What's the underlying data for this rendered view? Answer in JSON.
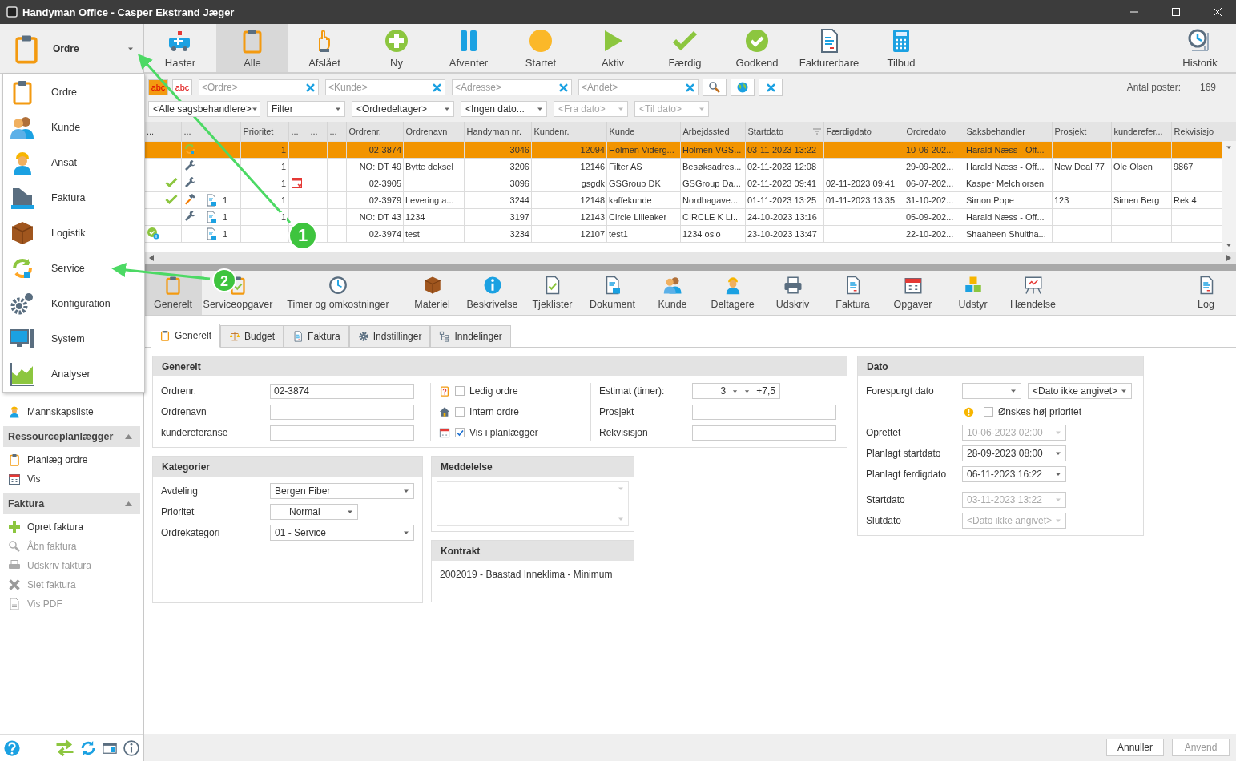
{
  "window": {
    "title": "Handyman Office - Casper Ekstrand Jæger"
  },
  "module_selector": {
    "label": "Ordre"
  },
  "module_menu": [
    {
      "label": "Ordre"
    },
    {
      "label": "Kunde"
    },
    {
      "label": "Ansat"
    },
    {
      "label": "Faktura"
    },
    {
      "label": "Logistik"
    },
    {
      "label": "Service"
    },
    {
      "label": "Konfiguration"
    },
    {
      "label": "System"
    },
    {
      "label": "Analyser"
    }
  ],
  "sidebar": {
    "items": [
      {
        "label": "Mannskapsliste",
        "disabled": false
      }
    ],
    "sections": [
      {
        "title": "Ressourceplanlægger",
        "expanded": true,
        "items": [
          {
            "label": "Planlæg ordre",
            "disabled": false
          },
          {
            "label": "Vis",
            "disabled": false
          }
        ]
      },
      {
        "title": "Faktura",
        "expanded": true,
        "items": [
          {
            "label": "Opret faktura",
            "disabled": false
          },
          {
            "label": "Åbn faktura",
            "disabled": true
          },
          {
            "label": "Udskriv faktura",
            "disabled": true
          },
          {
            "label": "Slet faktura",
            "disabled": true
          },
          {
            "label": "Vis PDF",
            "disabled": true
          }
        ]
      }
    ]
  },
  "toolbar": [
    {
      "label": "Haster",
      "selected": false
    },
    {
      "label": "Alle",
      "selected": true
    },
    {
      "label": "Afslået",
      "selected": false
    },
    {
      "label": "Ny",
      "selected": false
    },
    {
      "label": "Afventer",
      "selected": false
    },
    {
      "label": "Startet",
      "selected": false
    },
    {
      "label": "Aktiv",
      "selected": false
    },
    {
      "label": "Færdig",
      "selected": false
    },
    {
      "label": "Godkend",
      "selected": false
    },
    {
      "label": "Fakturerbare",
      "selected": false
    },
    {
      "label": "Tilbud",
      "selected": false
    },
    {
      "label": "Historik",
      "selected": false
    }
  ],
  "filters": {
    "text_toggles": [
      {
        "label": "abc",
        "selected": true
      },
      {
        "label": "abc",
        "selected": false
      }
    ],
    "search_fields": [
      {
        "placeholder": "<Ordre>"
      },
      {
        "placeholder": "<Kunde>"
      },
      {
        "placeholder": "<Adresse>"
      },
      {
        "placeholder": "<Andet>"
      }
    ],
    "count_label": "Antal poster:",
    "count": "169",
    "dropdowns": [
      {
        "value": "<Alle sagsbehandlere>",
        "disabled": false
      },
      {
        "value": "Filter",
        "disabled": false
      },
      {
        "value": "<Ordredeltager>",
        "disabled": false
      },
      {
        "value": "<Ingen dato...",
        "disabled": false
      },
      {
        "value": "<Fra dato>",
        "disabled": true
      },
      {
        "value": "<Til dato>",
        "disabled": true
      }
    ]
  },
  "table": {
    "columns": [
      "...",
      null,
      "...",
      null,
      "Prioritet",
      "...",
      "...",
      "...",
      "Ordrenr.",
      "Ordrenavn",
      "Handyman nr.",
      "Kundenr.",
      "Kunde",
      "Arbejdssted",
      "Startdato",
      "Færdigdato",
      "Ordredato",
      "Saksbehandler",
      "Prosjekt",
      "kunderefer...",
      "Rekvisisjo"
    ],
    "rows": [
      {
        "selected": true,
        "approved": false,
        "done": false,
        "kind": "service",
        "documents": false,
        "calendar_alert": false,
        "cells": [
          "",
          "",
          "",
          "",
          "1",
          "",
          "",
          "",
          "02-3874",
          "",
          "3046",
          "-12094",
          "Holmen Viderg...",
          "Holmen VGS...",
          "03-11-2023 13:22",
          "",
          "10-06-202...",
          "Harald Næss - Off...",
          "",
          "",
          ""
        ]
      },
      {
        "selected": false,
        "approved": false,
        "done": false,
        "kind": "wrench",
        "documents": false,
        "calendar_alert": false,
        "cells": [
          "",
          "",
          "",
          "",
          "1",
          "",
          "",
          "",
          "NO: DT 49",
          "Bytte deksel",
          "3206",
          "12146",
          "Filter AS",
          "Besøksadres...",
          "02-11-2023 12:08",
          "",
          "29-09-202...",
          "Harald Næss - Off...",
          "New Deal 77",
          "Ole Olsen",
          "9867"
        ]
      },
      {
        "selected": false,
        "approved": false,
        "done": true,
        "kind": "wrench",
        "documents": false,
        "calendar_alert": true,
        "cells": [
          "",
          "",
          "",
          "",
          "1",
          "",
          "",
          "",
          "02-3905",
          "",
          "3096",
          "gsgdk",
          "GSGroup DK",
          "GSGroup Da...",
          "02-11-2023 09:41",
          "02-11-2023 09:41",
          "06-07-202...",
          "Kasper Melchiorsen",
          "",
          "",
          ""
        ]
      },
      {
        "selected": false,
        "approved": false,
        "done": true,
        "kind": "hammer",
        "documents": true,
        "calendar_alert": false,
        "cells": [
          "",
          "",
          "",
          "1",
          "1",
          "",
          "",
          "",
          "02-3979",
          "Levering a...",
          "3244",
          "12148",
          "kaffekunde",
          "Nordhagave...",
          "01-11-2023 13:25",
          "01-11-2023 13:35",
          "31-10-202...",
          "Simon Pope",
          "123",
          "Simen Berg",
          "Rek 4"
        ]
      },
      {
        "selected": false,
        "approved": false,
        "done": false,
        "kind": "wrench",
        "documents": true,
        "calendar_alert": false,
        "cells": [
          "",
          "",
          "",
          "1",
          "1",
          "",
          "",
          "",
          "NO: DT 43",
          "1234",
          "3197",
          "12143",
          "Circle Lilleaker",
          "CIRCLE K LI...",
          "24-10-2023 13:16",
          "",
          "05-09-202...",
          "Harald Næss - Off...",
          "",
          "",
          ""
        ]
      },
      {
        "selected": false,
        "approved": true,
        "done": false,
        "kind": "none",
        "documents": true,
        "calendar_alert": false,
        "cells": [
          "",
          "",
          "",
          "1",
          "",
          "",
          "",
          "",
          "02-3974",
          "test",
          "3234",
          "12107",
          "test1",
          "1234 oslo",
          "23-10-2023 13:47",
          "",
          "22-10-202...",
          "Shaaheen Shultha...",
          "",
          "",
          ""
        ]
      }
    ]
  },
  "detail_toolbar": [
    {
      "label": "Generelt",
      "selected": true
    },
    {
      "label": "Serviceopgaver",
      "selected": false
    },
    {
      "label": "Timer og omkostninger",
      "selected": false
    },
    {
      "label": "Materiel",
      "selected": false
    },
    {
      "label": "Beskrivelse",
      "selected": false
    },
    {
      "label": "Tjeklister",
      "selected": false
    },
    {
      "label": "Dokument",
      "selected": false
    },
    {
      "label": "Kunde",
      "selected": false
    },
    {
      "label": "Deltagere",
      "selected": false
    },
    {
      "label": "Udskriv",
      "selected": false
    },
    {
      "label": "Faktura",
      "selected": false
    },
    {
      "label": "Opgaver",
      "selected": false
    },
    {
      "label": "Udstyr",
      "selected": false
    },
    {
      "label": "Hændelse",
      "selected": false
    },
    {
      "label": "Log",
      "selected": false
    }
  ],
  "tabs": [
    {
      "label": "Generelt",
      "selected": true
    },
    {
      "label": "Budget",
      "selected": false
    },
    {
      "label": "Faktura",
      "selected": false
    },
    {
      "label": "Indstillinger",
      "selected": false
    },
    {
      "label": "Inndelinger",
      "selected": false
    }
  ],
  "general": {
    "title": "Generelt",
    "fields": [
      {
        "label": "Ordrenr.",
        "value": "02-3874"
      },
      {
        "label": "Ordrenavn"
      },
      {
        "label": "kundereferanse"
      }
    ],
    "options": [
      {
        "label": "Ledig ordre",
        "checked": false
      },
      {
        "label": "Intern ordre",
        "checked": false
      },
      {
        "label": "Vis i planlægger",
        "checked": true
      }
    ],
    "estimate": {
      "label": "Estimat (timer):",
      "value": "3",
      "extra": "+7,5"
    },
    "extra_fields": [
      {
        "label": "Prosjekt"
      },
      {
        "label": "Rekvisisjon"
      }
    ]
  },
  "categories": {
    "title": "Kategorier",
    "fields": [
      {
        "label": "Avdeling",
        "value": "Bergen Fiber"
      },
      {
        "label": "Prioritet",
        "value": "Normal"
      },
      {
        "label": "Ordrekategori",
        "value": "01 - Service"
      }
    ]
  },
  "message": {
    "title": "Meddelelse"
  },
  "contract": {
    "title": "Kontrakt",
    "text": "2002019 - Baastad Inneklima - Minimum"
  },
  "dates": {
    "title": "Dato",
    "requested": {
      "label": "Forespurgt dato",
      "value": "<Dato ikke angivet>"
    },
    "priority": {
      "label": "Ønskes høj prioritet",
      "checked": false
    },
    "fields": [
      {
        "label": "Oprettet",
        "value": "10-06-2023 02:00",
        "disabled": true
      },
      {
        "label": "Planlagt startdato",
        "value": "28-09-2023 08:00",
        "disabled": false
      },
      {
        "label": "Planlagt ferdigdato",
        "value": "06-11-2023 16:22",
        "disabled": false
      },
      {
        "label": "Startdato",
        "value": "03-11-2023 13:22",
        "disabled": true
      },
      {
        "label": "Slutdato",
        "value": "<Dato ikke angivet>",
        "disabled": true
      }
    ]
  },
  "footer_buttons": [
    {
      "label": "Annuller",
      "disabled": false
    },
    {
      "label": "Anvend",
      "disabled": true
    }
  ],
  "annotations": [
    {
      "label": "1"
    },
    {
      "label": "2"
    }
  ]
}
